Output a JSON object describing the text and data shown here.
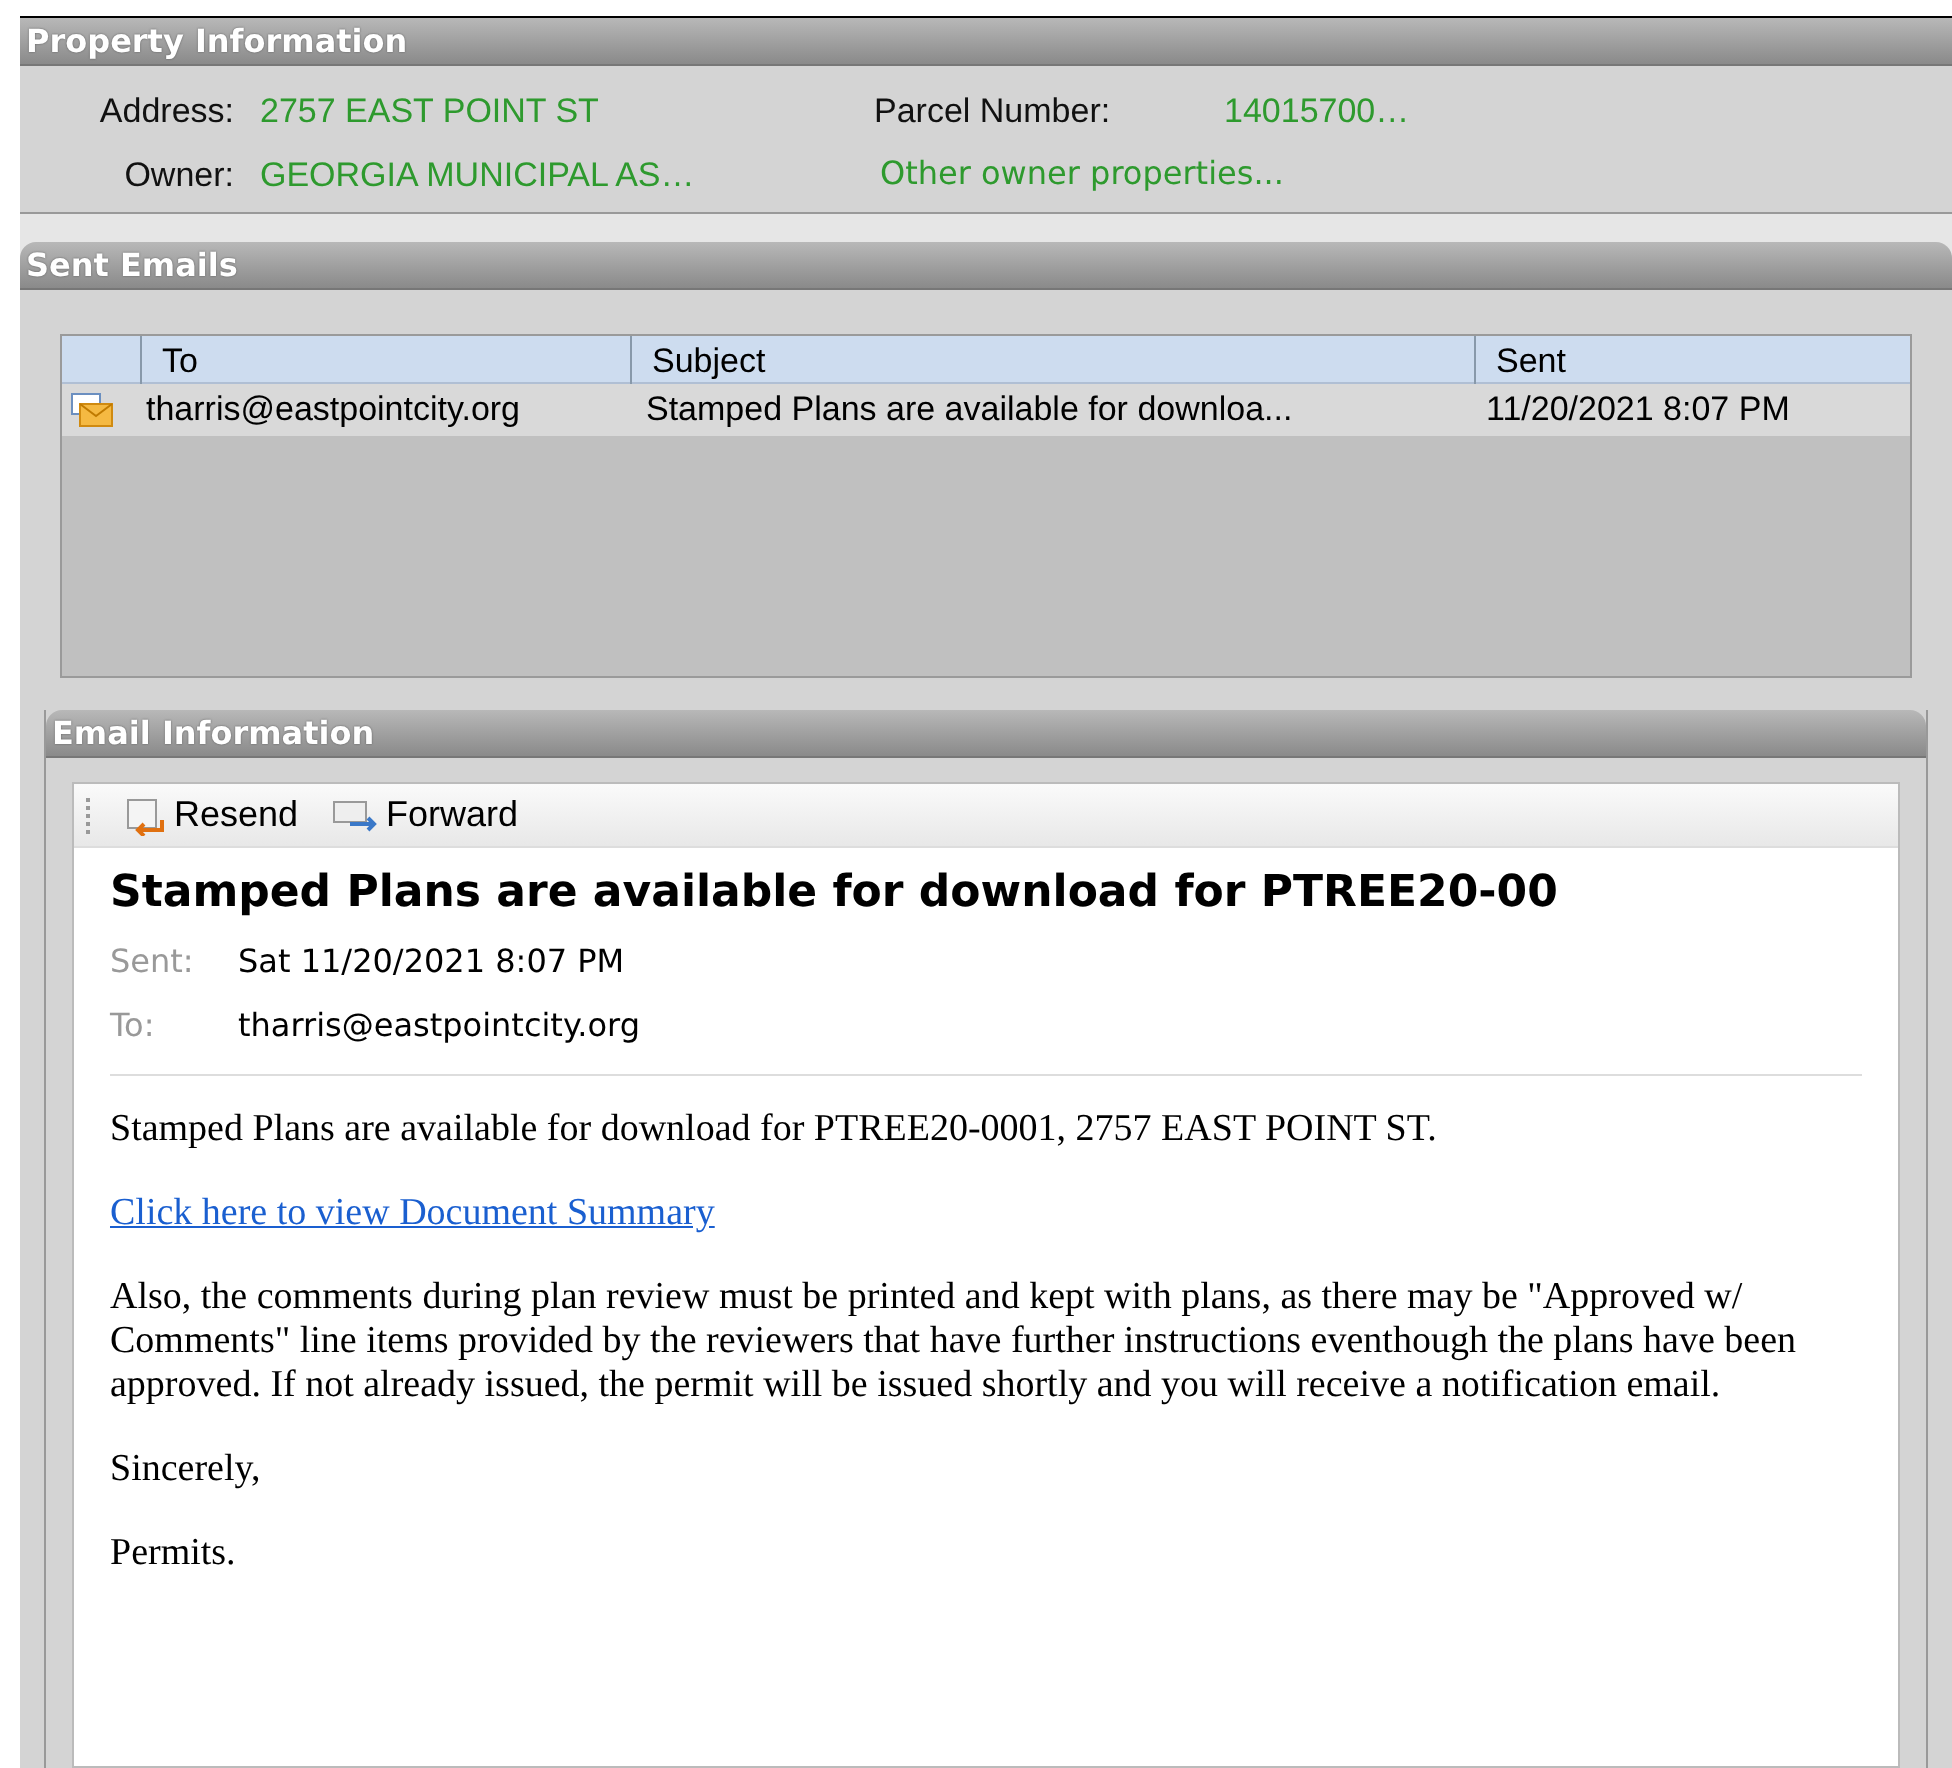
{
  "property_panel": {
    "title": "Property Information",
    "fields": [
      {
        "label": "Address:",
        "value": "2757 EAST POINT ST"
      },
      {
        "label": "Parcel Number:",
        "value": "14015700…"
      },
      {
        "label": "Owner:",
        "value": "GEORGIA  MUNICIPAL AS…"
      }
    ],
    "link": "Other owner properties..."
  },
  "sent_panel": {
    "title": "Sent Emails",
    "columns": [
      "To",
      "Subject",
      "Sent"
    ],
    "rows": [
      {
        "to": "tharris@eastpointcity.org",
        "subject": "Stamped Plans are available for downloa...",
        "sent": "11/20/2021 8:07 PM",
        "selected": true
      }
    ]
  },
  "email_panel": {
    "title": "Email Information",
    "toolbar": [
      "Resend",
      "Forward"
    ],
    "subject": "Stamped Plans are available for download for PTREE20-00",
    "meta": [
      {
        "label": "Sent:",
        "value": "Sat 11/20/2021 8:07 PM"
      },
      {
        "label": "To:",
        "value": "tharris@eastpointcity.org"
      }
    ],
    "body": [
      {
        "kind": "text",
        "text": "Stamped Plans are available for download for PTREE20-0001, 2757 EAST POINT ST."
      },
      {
        "kind": "link",
        "text": "Click here to view Document Summary"
      },
      {
        "kind": "text",
        "text": "Also, the comments during plan review must be printed and kept with plans, as there may be \"Approved w/ Comments\" line items provided by the reviewers that have further instructions eventhough the plans have been approved. If not already issued, the permit will be issued shortly and you will receive a notification email."
      },
      {
        "kind": "text",
        "text": "Sincerely,"
      },
      {
        "kind": "text",
        "text": "Permits."
      }
    ]
  }
}
